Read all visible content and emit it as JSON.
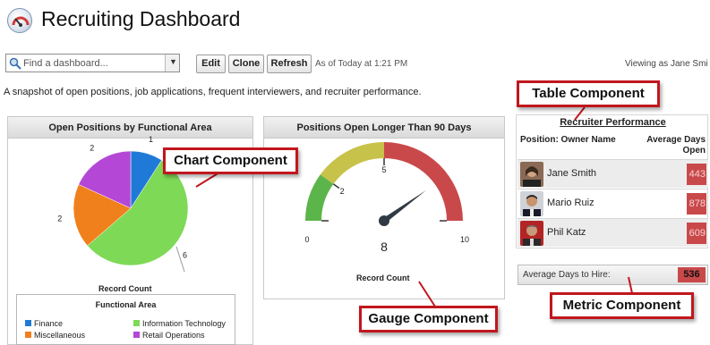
{
  "header": {
    "title": "Recruiting Dashboard"
  },
  "toolbar": {
    "search_placeholder": "Find a dashboard...",
    "edit_label": "Edit",
    "clone_label": "Clone",
    "refresh_label": "Refresh",
    "as_of": "As of Today at 1:21 PM",
    "viewing_as": "Viewing as Jane Smi"
  },
  "description": "A snapshot of open positions, job applications, frequent interviewers, and recruiter performance.",
  "chart_panel": {
    "title": "Open Positions by Functional Area",
    "footer": "Record Count",
    "legend_title": "Functional Area"
  },
  "chart_data": [
    {
      "type": "pie",
      "title": "Open Positions by Functional Area",
      "xlabel": "Record Count",
      "legend_title": "Functional Area",
      "legend_position": "bottom",
      "categories": [
        "Finance",
        "Information Technology",
        "Miscellaneous",
        "Retail Operations"
      ],
      "values": [
        1,
        6,
        2,
        2
      ],
      "colors": [
        "#1f7ad7",
        "#7ed957",
        "#f0801b",
        "#b547d6"
      ]
    },
    {
      "type": "gauge",
      "title": "Positions Open Longer Than 90 Days",
      "xlabel": "Record Count",
      "value": 8,
      "min": 0,
      "max": 10,
      "ticks": [
        0,
        2,
        5,
        10
      ],
      "ranges": [
        {
          "from": 0,
          "to": 2,
          "color": "#5cb54a"
        },
        {
          "from": 2,
          "to": 5,
          "color": "#c7c24a"
        },
        {
          "from": 5,
          "to": 10,
          "color": "#c9494b"
        }
      ]
    }
  ],
  "gauge_panel": {
    "title": "Positions Open Longer Than 90 Days",
    "footer": "Record Count",
    "value_label": "8"
  },
  "table": {
    "title": "Recruiter Performance",
    "col1": "Position: Owner Name",
    "col2": "Average Days Open",
    "rows": [
      {
        "name": "Jane Smith",
        "value": "443"
      },
      {
        "name": "Mario Ruiz",
        "value": "878"
      },
      {
        "name": "Phil Katz",
        "value": "609"
      }
    ]
  },
  "metric": {
    "label": "Average Days to Hire:",
    "value": "536"
  },
  "callouts": {
    "chart": "Chart Component",
    "gauge": "Gauge Component",
    "table": "Table Component",
    "metric": "Metric Component"
  }
}
